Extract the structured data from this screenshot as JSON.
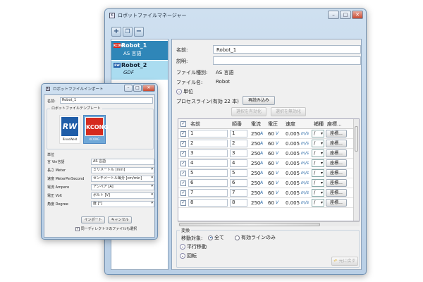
{
  "main_window": {
    "title": "ロボットファイルマネージャー",
    "robots": [
      {
        "brand": "KCONG",
        "name": "Robot_1",
        "sub": "AS 言語"
      },
      {
        "brand": "RW",
        "name": "Robot_2",
        "sub": "GDF"
      }
    ],
    "fields": {
      "name_label": "名前:",
      "name_value": "Robot_1",
      "desc_label": "説明:",
      "desc_value": "",
      "filetype_label": "ファイル種別:",
      "filetype_value": "AS 言語",
      "filename_label": "ファイル名:",
      "filename_value": "Robot"
    },
    "unit_section": "単位",
    "process_line_label": "プロセスライン(有効 22 本)",
    "reload_button": "再読み込み",
    "enable_selected_button": "選択を有効化",
    "disable_selected_button": "選択を無効化",
    "columns": [
      "名前",
      "順番",
      "電流",
      "電圧",
      "速度",
      "補種",
      "座標..."
    ],
    "rows": [
      {
        "name": "1",
        "order": "1",
        "current": "250",
        "voltage": "60",
        "speed": "0.005"
      },
      {
        "name": "2",
        "order": "2",
        "current": "250",
        "voltage": "60",
        "speed": "0.005"
      },
      {
        "name": "3",
        "order": "3",
        "current": "250",
        "voltage": "60",
        "speed": "0.005"
      },
      {
        "name": "4",
        "order": "4",
        "current": "250",
        "voltage": "60",
        "speed": "0.005"
      },
      {
        "name": "5",
        "order": "5",
        "current": "250",
        "voltage": "60",
        "speed": "0.005"
      },
      {
        "name": "6",
        "order": "6",
        "current": "250",
        "voltage": "60",
        "speed": "0.005"
      },
      {
        "name": "7",
        "order": "7",
        "current": "250",
        "voltage": "60",
        "speed": "0.005"
      },
      {
        "name": "8",
        "order": "8",
        "current": "250",
        "voltage": "60",
        "speed": "0.005"
      }
    ],
    "units": {
      "current": "A",
      "voltage": "V",
      "speed": "m/s"
    },
    "interp_value": "/",
    "coord_button": "座標...",
    "transform_label": "変換",
    "target_label": "移動対象:",
    "radio_all": "全て",
    "radio_enabled": "有効ラインのみ",
    "translate_label": "平行移動",
    "rotate_label": "回転",
    "restore_button": "元に戻す"
  },
  "import_window": {
    "title": "ロボットファイルインポート",
    "name_label": "名前:",
    "name_value": "Robot_1",
    "template_label": "ロボットファイルテンプレート",
    "templates": [
      {
        "logo": "RW",
        "caption": "RinseWeld"
      },
      {
        "logo": "KCONG",
        "caption": "KCONG"
      }
    ],
    "unit_label": "単位",
    "unit_rows": [
      {
        "key": "言",
        "key2": "Vin言語",
        "value": "AS 言語"
      },
      {
        "key": "長さ",
        "key2": "Meter",
        "value": "ミリメートル [mm]"
      },
      {
        "key": "速度",
        "key2": "MeterPerSecond",
        "value": "センチメートル毎分 [cm/min]"
      },
      {
        "key": "電流",
        "key2": "Ampere",
        "value": "アンペア [A]"
      },
      {
        "key": "電圧",
        "key2": "Volt",
        "value": "ボルト [V]"
      },
      {
        "key": "角度",
        "key2": "Degree",
        "value": "度 [°]"
      }
    ],
    "import_button": "インポート",
    "cancel_button": "キャンセル",
    "same_dir_label": "同一ディレクトリのファイルも選択"
  }
}
